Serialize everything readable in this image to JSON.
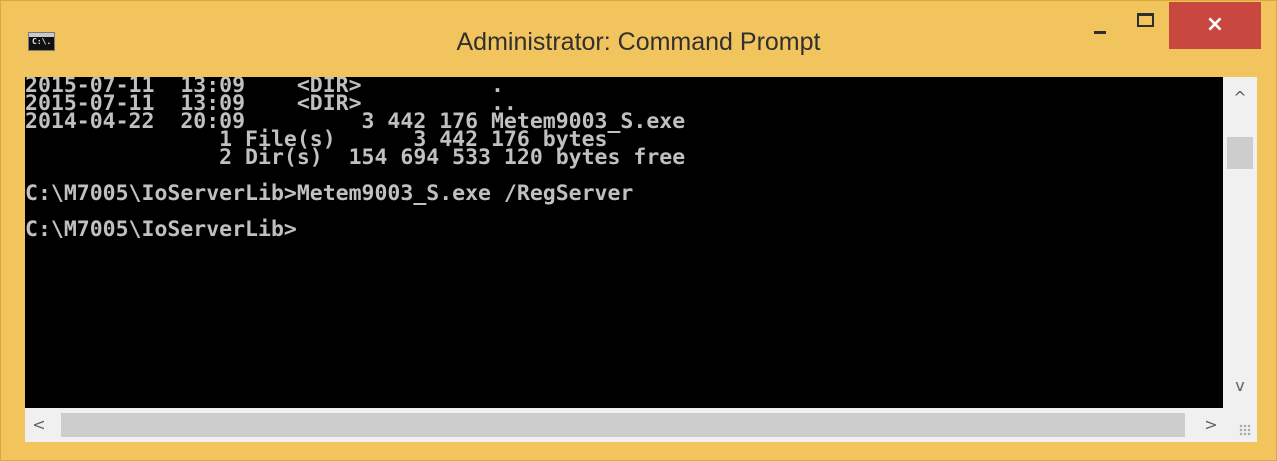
{
  "window": {
    "title": "Administrator: Command Prompt",
    "app_icon_text": "C:\\.",
    "close_glyph": "×"
  },
  "console": {
    "lines": [
      "2015-07-11  13:09    <DIR>          .",
      "2015-07-11  13:09    <DIR>          ..",
      "2014-04-22  20:09         3 442 176 Metem9003_S.exe",
      "               1 File(s)      3 442 176 bytes",
      "               2 Dir(s)  154 694 533 120 bytes free",
      "",
      "C:\\M7005\\IoServerLib>Metem9003_S.exe /RegServer",
      "",
      "C:\\M7005\\IoServerLib>"
    ],
    "text_color": "#c0c0c0",
    "background": "#000000"
  },
  "scrollbars": {
    "up_arrow": "^",
    "down_arrow": "v",
    "left_arrow": "<",
    "right_arrow": ">"
  },
  "colors": {
    "frame": "#f2c45d",
    "close_button": "#c8473e"
  }
}
